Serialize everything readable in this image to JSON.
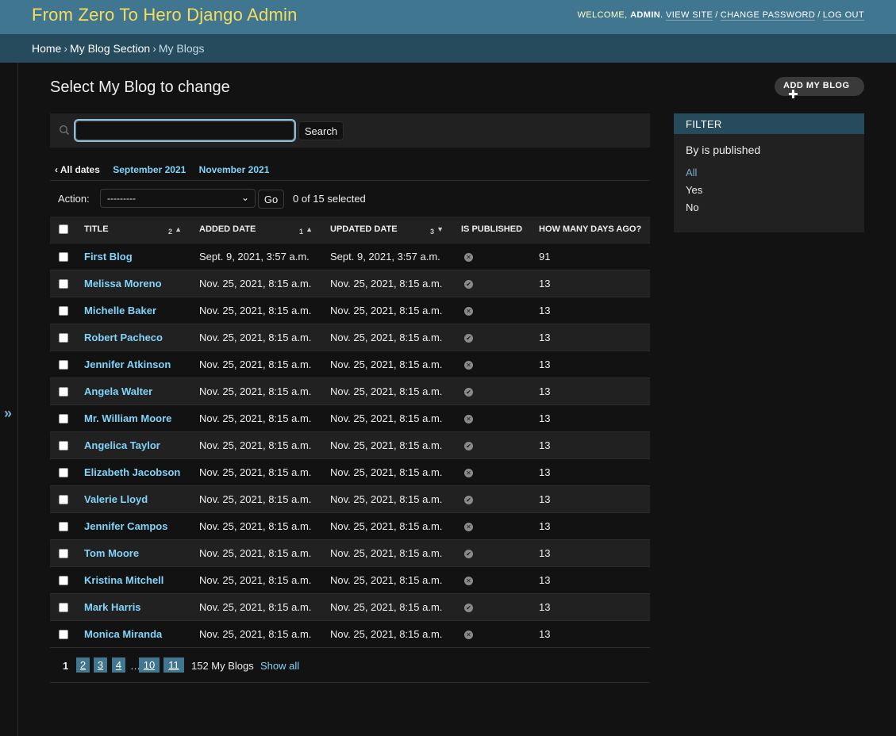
{
  "header": {
    "branding": "From Zero To Hero Django Admin",
    "welcome": "WELCOME,",
    "username": "ADMIN",
    "view_site": "VIEW SITE",
    "change_password": "CHANGE PASSWORD",
    "log_out": "LOG OUT"
  },
  "breadcrumbs": {
    "home": "Home",
    "section": "My Blog Section",
    "current": "My Blogs"
  },
  "sidebar_toggle": "»",
  "page_title": "Select My Blog to change",
  "add_button": "ADD MY BLOG",
  "search": {
    "value": "",
    "button": "Search"
  },
  "date_hierarchy": {
    "all_dates": "‹ All dates",
    "items": [
      "September 2021",
      "November 2021"
    ]
  },
  "actions": {
    "label": "Action:",
    "selected": "---------",
    "go": "Go",
    "counter": "0 of 15 selected"
  },
  "table": {
    "columns": [
      {
        "label": "TITLE",
        "sort_priority": "2",
        "sort_dir": "▲"
      },
      {
        "label": "ADDED DATE",
        "sort_priority": "1",
        "sort_dir": "▲"
      },
      {
        "label": "UPDATED DATE",
        "sort_priority": "3",
        "sort_dir": "▼"
      },
      {
        "label": "IS PUBLISHED",
        "sort_priority": "",
        "sort_dir": ""
      },
      {
        "label": "HOW MANY DAYS AGO?",
        "sort_priority": "",
        "sort_dir": ""
      }
    ],
    "rows": [
      {
        "title": "First Blog",
        "added": "Sept. 9, 2021, 3:57 a.m.",
        "updated": "Sept. 9, 2021, 3:57 a.m.",
        "published": false,
        "days": "91"
      },
      {
        "title": "Melissa Moreno",
        "added": "Nov. 25, 2021, 8:15 a.m.",
        "updated": "Nov. 25, 2021, 8:15 a.m.",
        "published": true,
        "days": "13"
      },
      {
        "title": "Michelle Baker",
        "added": "Nov. 25, 2021, 8:15 a.m.",
        "updated": "Nov. 25, 2021, 8:15 a.m.",
        "published": false,
        "days": "13"
      },
      {
        "title": "Robert Pacheco",
        "added": "Nov. 25, 2021, 8:15 a.m.",
        "updated": "Nov. 25, 2021, 8:15 a.m.",
        "published": true,
        "days": "13"
      },
      {
        "title": "Jennifer Atkinson",
        "added": "Nov. 25, 2021, 8:15 a.m.",
        "updated": "Nov. 25, 2021, 8:15 a.m.",
        "published": false,
        "days": "13"
      },
      {
        "title": "Angela Walter",
        "added": "Nov. 25, 2021, 8:15 a.m.",
        "updated": "Nov. 25, 2021, 8:15 a.m.",
        "published": true,
        "days": "13"
      },
      {
        "title": "Mr. William Moore",
        "added": "Nov. 25, 2021, 8:15 a.m.",
        "updated": "Nov. 25, 2021, 8:15 a.m.",
        "published": false,
        "days": "13"
      },
      {
        "title": "Angelica Taylor",
        "added": "Nov. 25, 2021, 8:15 a.m.",
        "updated": "Nov. 25, 2021, 8:15 a.m.",
        "published": true,
        "days": "13"
      },
      {
        "title": "Elizabeth Jacobson",
        "added": "Nov. 25, 2021, 8:15 a.m.",
        "updated": "Nov. 25, 2021, 8:15 a.m.",
        "published": false,
        "days": "13"
      },
      {
        "title": "Valerie Lloyd",
        "added": "Nov. 25, 2021, 8:15 a.m.",
        "updated": "Nov. 25, 2021, 8:15 a.m.",
        "published": true,
        "days": "13"
      },
      {
        "title": "Jennifer Campos",
        "added": "Nov. 25, 2021, 8:15 a.m.",
        "updated": "Nov. 25, 2021, 8:15 a.m.",
        "published": false,
        "days": "13"
      },
      {
        "title": "Tom Moore",
        "added": "Nov. 25, 2021, 8:15 a.m.",
        "updated": "Nov. 25, 2021, 8:15 a.m.",
        "published": true,
        "days": "13"
      },
      {
        "title": "Kristina Mitchell",
        "added": "Nov. 25, 2021, 8:15 a.m.",
        "updated": "Nov. 25, 2021, 8:15 a.m.",
        "published": false,
        "days": "13"
      },
      {
        "title": "Mark Harris",
        "added": "Nov. 25, 2021, 8:15 a.m.",
        "updated": "Nov. 25, 2021, 8:15 a.m.",
        "published": true,
        "days": "13"
      },
      {
        "title": "Monica Miranda",
        "added": "Nov. 25, 2021, 8:15 a.m.",
        "updated": "Nov. 25, 2021, 8:15 a.m.",
        "published": false,
        "days": "13"
      }
    ]
  },
  "pagination": {
    "current": "1",
    "pages": [
      "2",
      "3",
      "4"
    ],
    "ellipsis": "…",
    "last_pages": [
      "10",
      "11"
    ],
    "total": "152 My Blogs",
    "show_all": "Show all"
  },
  "filter": {
    "header": "FILTER",
    "title": "By is published",
    "options": [
      {
        "label": "All",
        "selected": true
      },
      {
        "label": "Yes",
        "selected": false
      },
      {
        "label": "No",
        "selected": false
      }
    ]
  },
  "colors": {
    "header_bg": "#417690",
    "breadcrumbs_bg": "#264b5d",
    "branding": "#f5dd5d",
    "link": "#81d4fa",
    "background": "#121212"
  }
}
